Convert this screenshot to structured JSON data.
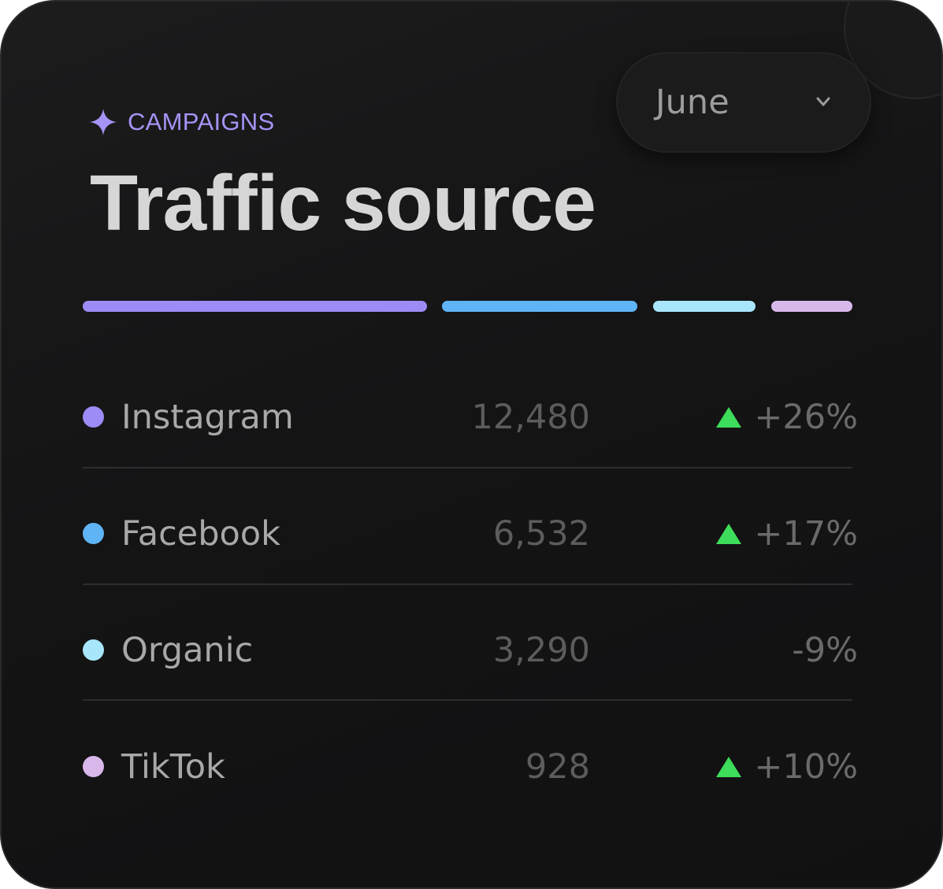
{
  "widget": {
    "eyebrow": "CAMPAIGNS",
    "eyebrow_icon": "sparkle-icon",
    "title": "Traffic source",
    "period_select": {
      "selected": "June",
      "icon": "chevron-down-icon"
    },
    "distribution_bar": [
      {
        "name": "Instagram",
        "color": "#9d8cf6"
      },
      {
        "name": "Facebook",
        "color": "#5fb4f5"
      },
      {
        "name": "Organic",
        "color": "#a8e6fb"
      },
      {
        "name": "TikTok",
        "color": "#d8b8ea"
      }
    ],
    "sources": [
      {
        "name": "Instagram",
        "value": "12,480",
        "change": "+26%",
        "trend": "up",
        "color": "#9d8cf6"
      },
      {
        "name": "Facebook",
        "value": "6,532",
        "change": "+17%",
        "trend": "up",
        "color": "#5fb4f5"
      },
      {
        "name": "Organic",
        "value": "3,290",
        "change": "-9%",
        "trend": "none",
        "color": "#a8e6fb"
      },
      {
        "name": "TikTok",
        "value": "928",
        "change": "+10%",
        "trend": "up",
        "color": "#d8b8ea"
      }
    ],
    "trend_up_color": "#3ddc5a"
  }
}
